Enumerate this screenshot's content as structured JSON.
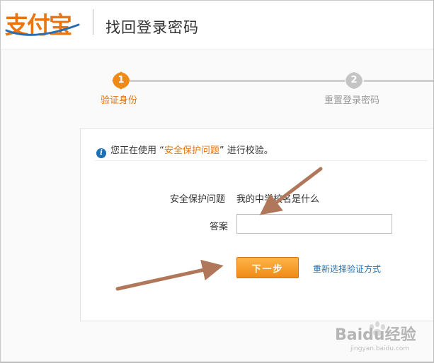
{
  "header": {
    "logo_text": "支付宝",
    "title": "找回登录密码"
  },
  "steps": [
    {
      "number": "1",
      "label": "验证身份",
      "state": "active"
    },
    {
      "number": "2",
      "label": "重置登录密码",
      "state": "inactive"
    }
  ],
  "info": {
    "prefix": "您正在使用 “",
    "method": "安全保护问题",
    "suffix": "” 进行校验。"
  },
  "form": {
    "question_label": "安全保护问题",
    "question_value": "我的中学校名是什么",
    "answer_label": "答案",
    "answer_value": ""
  },
  "actions": {
    "next_label": "下一步",
    "alt_link_label": "重新选择验证方式"
  },
  "watermark": {
    "text": "Baidu经验",
    "subtext": "jingyan.baidu.com"
  },
  "colors": {
    "accent": "#e8750f",
    "link": "#1f6fb3",
    "annotation_arrow": "#b0775a",
    "step_inactive": "#cfcfcf"
  }
}
